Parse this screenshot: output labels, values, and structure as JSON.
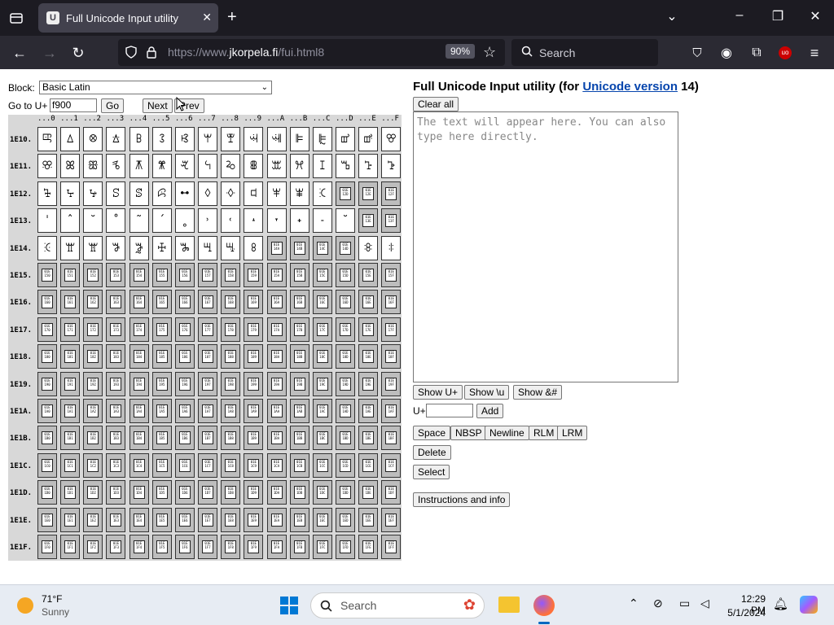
{
  "browser": {
    "tab_title": "Full Unicode Input utility",
    "url_prefix": "https://www.",
    "url_domain": "jkorpela.fi",
    "url_path": "/fui.html8",
    "zoom": "90%",
    "search_placeholder": "Search"
  },
  "page": {
    "block_label": "Block:",
    "block_selected": "Basic Latin",
    "goto_label": "Go to U+",
    "goto_value": "f900",
    "go_button": "Go",
    "next_button": "Next",
    "prev_button": "Prev",
    "heading_text": "Full Unicode Input utility (for ",
    "heading_link": "Unicode version",
    "heading_suffix": " 14)",
    "clear_all": "Clear all",
    "textarea_placeholder": "The text will appear here. You can also type here directly.",
    "show_u_plus": "Show U+",
    "show_backslash_u": "Show \\u",
    "show_entity": "Show &#",
    "uplus_label": "U+",
    "add_button": "Add",
    "space_button": "Space",
    "nbsp_button": "NBSP",
    "newline_button": "Newline",
    "rlm_button": "RLM",
    "lrm_button": "LRM",
    "delete_button": "Delete",
    "select_button": "Select",
    "instructions_button": "Instructions and info"
  },
  "grid": {
    "col_headers": [
      "...0",
      "...1",
      "...2",
      "...3",
      "...4",
      "...5",
      "...6",
      "...7",
      "...8",
      "...9",
      "...A",
      "...B",
      "...C",
      "...D",
      "...E",
      "...F"
    ],
    "row_headers": [
      "1E10.",
      "1E11.",
      "1E12.",
      "1E13.",
      "1E14.",
      "1E15.",
      "1E16.",
      "1E17.",
      "1E18.",
      "1E19.",
      "1E1A.",
      "1E1B.",
      "1E1C.",
      "1E1D.",
      "1E1E.",
      "1E1F."
    ],
    "glyphs": [
      [
        "ꕓ",
        "ꕔ",
        "ꕕ",
        "ꕖ",
        "ꕗ",
        "ꕘ",
        "ꕙ",
        "ꕚ",
        "ꕛ",
        "ꕜ",
        "ꕝ",
        "ꕞ",
        "ꕟ",
        "ꕠ",
        "ꕡ",
        "ꕢ"
      ],
      [
        "ꕣ",
        "ꕤ",
        "ꕥ",
        "ꕦ",
        "ꕧ",
        "ꕨ",
        "ꕩ",
        "ꕪ",
        "ꕫ",
        "ꕬ",
        "ꕭ",
        "ꕮ",
        "ꕯ",
        "ꕰ",
        "ꕱ",
        "ꕲ"
      ],
      [
        "ꕳ",
        "ꕴ",
        "ꕵ",
        "ꕶ",
        "ꕷ",
        "ꕸ",
        "ꕹ",
        "ꕺ",
        "ꕻ",
        "ꕼ",
        "ꕽ",
        "ꕾ",
        "ꕿ",
        "",
        "",
        ""
      ],
      [
        "ˈ",
        "ˆ",
        "˘",
        "˚",
        "˜",
        "ˊ",
        "˳",
        "˒",
        "˓",
        "˔",
        "˕",
        "˖",
        "˗",
        "˘",
        "",
        ""
      ],
      [
        "ꖀ",
        "ꖁ",
        "ꖂ",
        "ꖃ",
        "ꖄ",
        "ꖅ",
        "ꖆ",
        "ꖇ",
        "ꖈ",
        "ꖉ",
        "",
        "",
        "",
        "",
        "ꖊ",
        "ꖋ"
      ]
    ],
    "blank_cells": [
      [
        2,
        13
      ],
      [
        2,
        14
      ],
      [
        2,
        15
      ],
      [
        3,
        14
      ],
      [
        3,
        15
      ],
      [
        4,
        10
      ],
      [
        4,
        11
      ],
      [
        4,
        12
      ],
      [
        4,
        13
      ]
    ]
  },
  "taskbar": {
    "temp": "71°F",
    "weather": "Sunny",
    "search": "Search",
    "time": "12:29 PM",
    "date": "5/1/2024"
  }
}
